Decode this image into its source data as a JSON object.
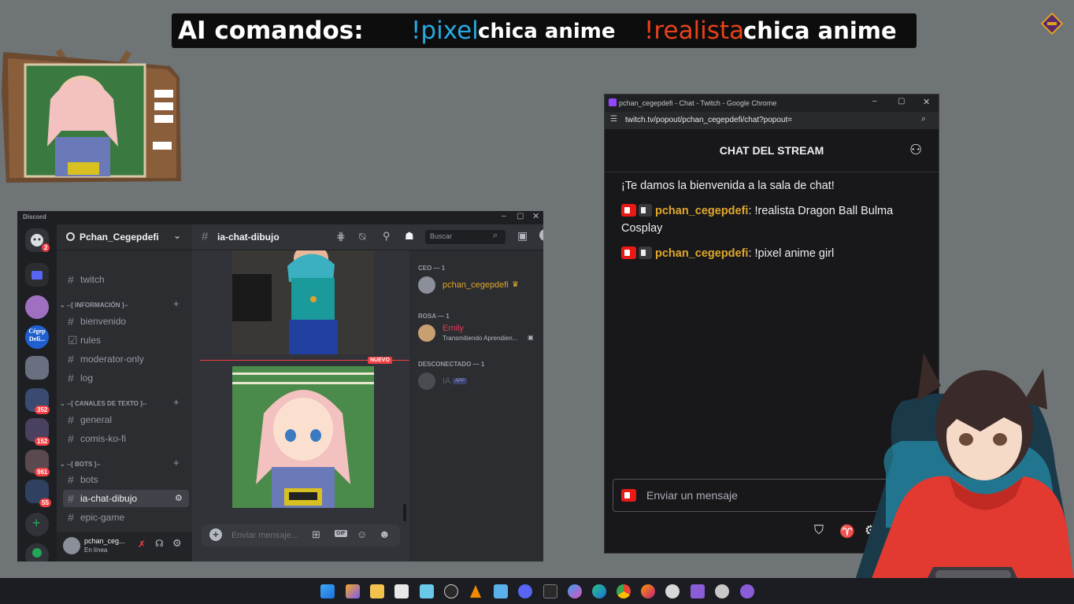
{
  "banner": {
    "prefix": "AI comandos:",
    "cmd1": "!pixel",
    "cmd1_text": "chica anime",
    "cmd2": "!realista",
    "cmd2_text": "chica anime",
    "cmd1_color": "#29a8e0",
    "cmd2_color": "#e8421a"
  },
  "discord": {
    "app_title": "Discord",
    "server_name": "Pchan_Cegepdefi",
    "server_badges": [
      "2",
      "352",
      "152",
      "961",
      "55"
    ],
    "server_label": "Cégep Defi...",
    "channels": [
      {
        "type": "category",
        "label": "--[ INFORMACIÓN ]--"
      },
      {
        "label": "twitch"
      },
      {
        "label": "bienvenido"
      },
      {
        "label": "rules"
      },
      {
        "label": "moderator-only"
      },
      {
        "label": "log"
      },
      {
        "type": "category",
        "label": "--[ CANALES DE TEXTO ]--"
      },
      {
        "label": "general"
      },
      {
        "label": "comis-ko-fi"
      },
      {
        "type": "category",
        "label": "--[ BOTS ]--"
      },
      {
        "label": "bots"
      },
      {
        "label": "ia-chat-dibujo"
      },
      {
        "label": "epic-game"
      }
    ],
    "active_channel": "ia-chat-dibujo",
    "search_placeholder": "Buscar",
    "new_label": "NUEVO",
    "message_placeholder": "Enviar mensaje...",
    "user_name": "pchan_ceg...",
    "user_status": "En línea",
    "members": {
      "group1": "CEO — 1",
      "member1": "pchan_cegepdefi",
      "group2": "ROSA — 1",
      "member2": "Emily",
      "member2_status": "Transmitiendo Aprendien...",
      "group3": "DESCONECTADO — 1",
      "member3": "IA",
      "member3_tag": "APP"
    }
  },
  "chrome": {
    "window_title": "pchan_cegepdefi - Chat - Twitch - Google Chrome",
    "url": "twitch.tv/popout/pchan_cegepdefi/chat?popout=",
    "chat_header": "CHAT DEL STREAM",
    "welcome": "¡Te damos la bienvenida a la sala de chat!",
    "messages": [
      {
        "user": "pchan_cegepdefi",
        "text": ": !realista Dragon Ball Bulma Cosplay"
      },
      {
        "user": "pchan_cegepdefi",
        "text": ": !pixel anime girl"
      }
    ],
    "input_placeholder": "Enviar un mensaje",
    "user_color": "#e0a72b"
  },
  "colors": {
    "desktop": "#6f7476",
    "discord_bg": "#313338",
    "twitch_bg": "#18181b",
    "accent_red": "#e91916"
  }
}
